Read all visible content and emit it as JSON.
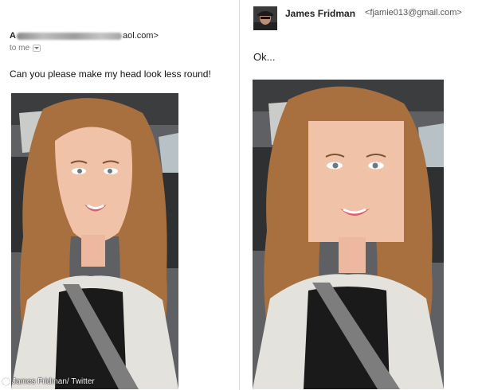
{
  "left_email": {
    "sender_initial": "A",
    "sender_domain": "aol.com>",
    "recipient_label": "to me",
    "message": "Can you please make my head look less round!"
  },
  "right_email": {
    "sender_name": "James Fridman",
    "sender_email": "<fjamie013@gmail.com>",
    "message": "Ok..."
  },
  "watermark": "James Fridman/ Twitter",
  "icons": {
    "dropdown": "chevron-down-icon",
    "avatar": "avatar",
    "copyright": "copyright-icon"
  },
  "colors": {
    "divider": "#d9d9d9",
    "hair": "#a8703f",
    "skin": "#f0c2a8",
    "lips": "#d9606e",
    "shirt": "#1a1a1a",
    "cardigan": "#e4e2dc"
  }
}
